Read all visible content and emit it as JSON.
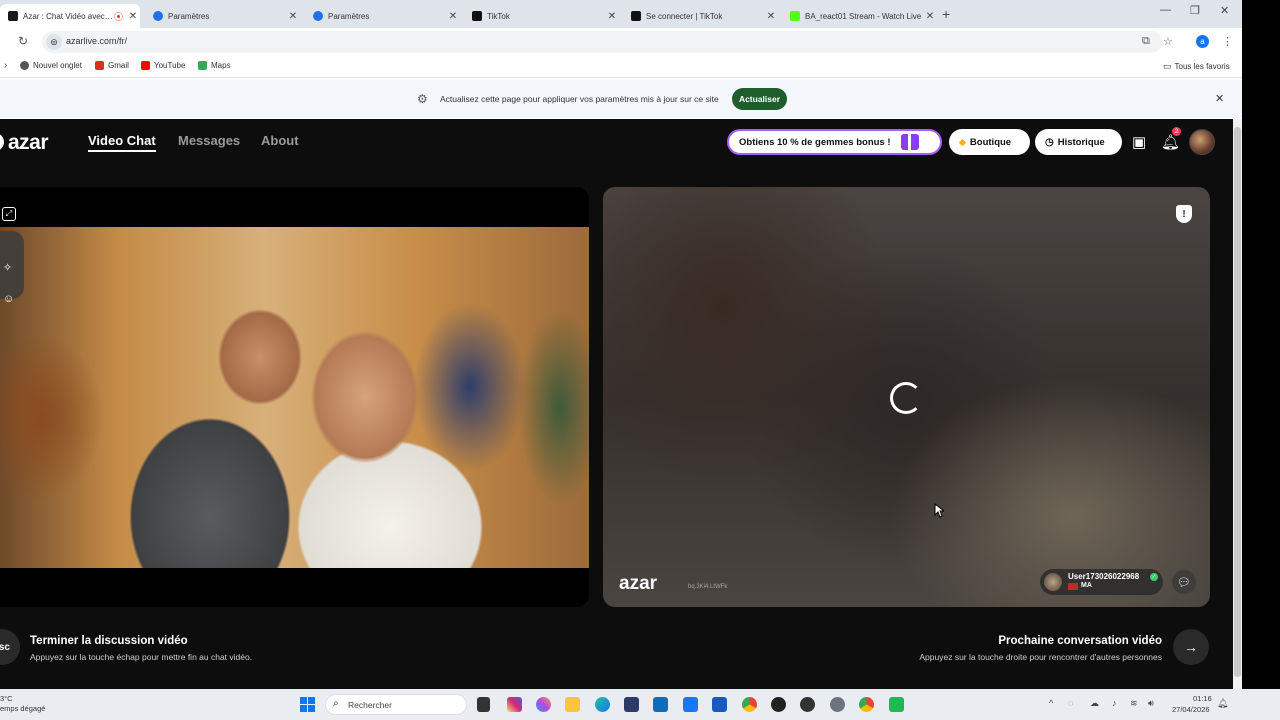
{
  "browser": {
    "tabs": [
      {
        "label": "Azar : Chat Vidéo avec de n",
        "active": true,
        "favicon_color": "#1a1a1a"
      },
      {
        "label": "Paramètres",
        "active": false,
        "favicon_color": "#1a73e8"
      },
      {
        "label": "Paramètres",
        "active": false,
        "favicon_color": "#1a73e8"
      },
      {
        "label": "TikTok",
        "active": false,
        "favicon_color": "#111111"
      },
      {
        "label": "Se connecter | TikTok",
        "active": false,
        "favicon_color": "#111111"
      },
      {
        "label": "BA_react01 Stream - Watch Live",
        "active": false,
        "favicon_color": "#53fc18"
      }
    ],
    "url": "azarlive.com/fr/",
    "profile_initial": "a",
    "bookmarks": [
      {
        "label": "Nouvel onglet",
        "icon": "globe-icon",
        "color": "#555555"
      },
      {
        "label": "Gmail",
        "icon": "gmail-icon",
        "color": "#d93025"
      },
      {
        "label": "YouTube",
        "icon": "youtube-icon",
        "color": "#ff0000"
      },
      {
        "label": "Maps",
        "icon": "maps-icon",
        "color": "#34a853"
      }
    ],
    "all_bookmarks_label": "Tous les favoris",
    "infobar": {
      "message": "Actualisez cette page pour appliquer vos paramètres mis à jour sur ce site",
      "button": "Actualiser"
    }
  },
  "app": {
    "logo": "azar",
    "nav": [
      "Video Chat",
      "Messages",
      "About"
    ],
    "promo_label": "Obtiens 10 % de gemmes bonus !",
    "shop_label": "Boutique",
    "history_label": "Historique",
    "notification_count": "2",
    "partner": {
      "watermark": "azar",
      "watermark_id": "bq.3Ki4.LtWFk",
      "username": "User173026022968",
      "country": "MA"
    },
    "hints": {
      "end_key": "sc",
      "end_title": "Terminer la discussion vidéo",
      "end_sub": "Appuyez sur la touche échap pour mettre fin au chat vidéo.",
      "next_title": "Prochaine conversation vidéo",
      "next_sub": "Appuyez sur la touche droite pour rencontrer d'autres personnes"
    },
    "accent_color": "#a75cff"
  },
  "taskbar": {
    "weather_temp": "3°C",
    "weather_desc": "emps dégagé",
    "search_placeholder": "Rechercher",
    "time": "01:16",
    "date": "27/04/2026"
  }
}
